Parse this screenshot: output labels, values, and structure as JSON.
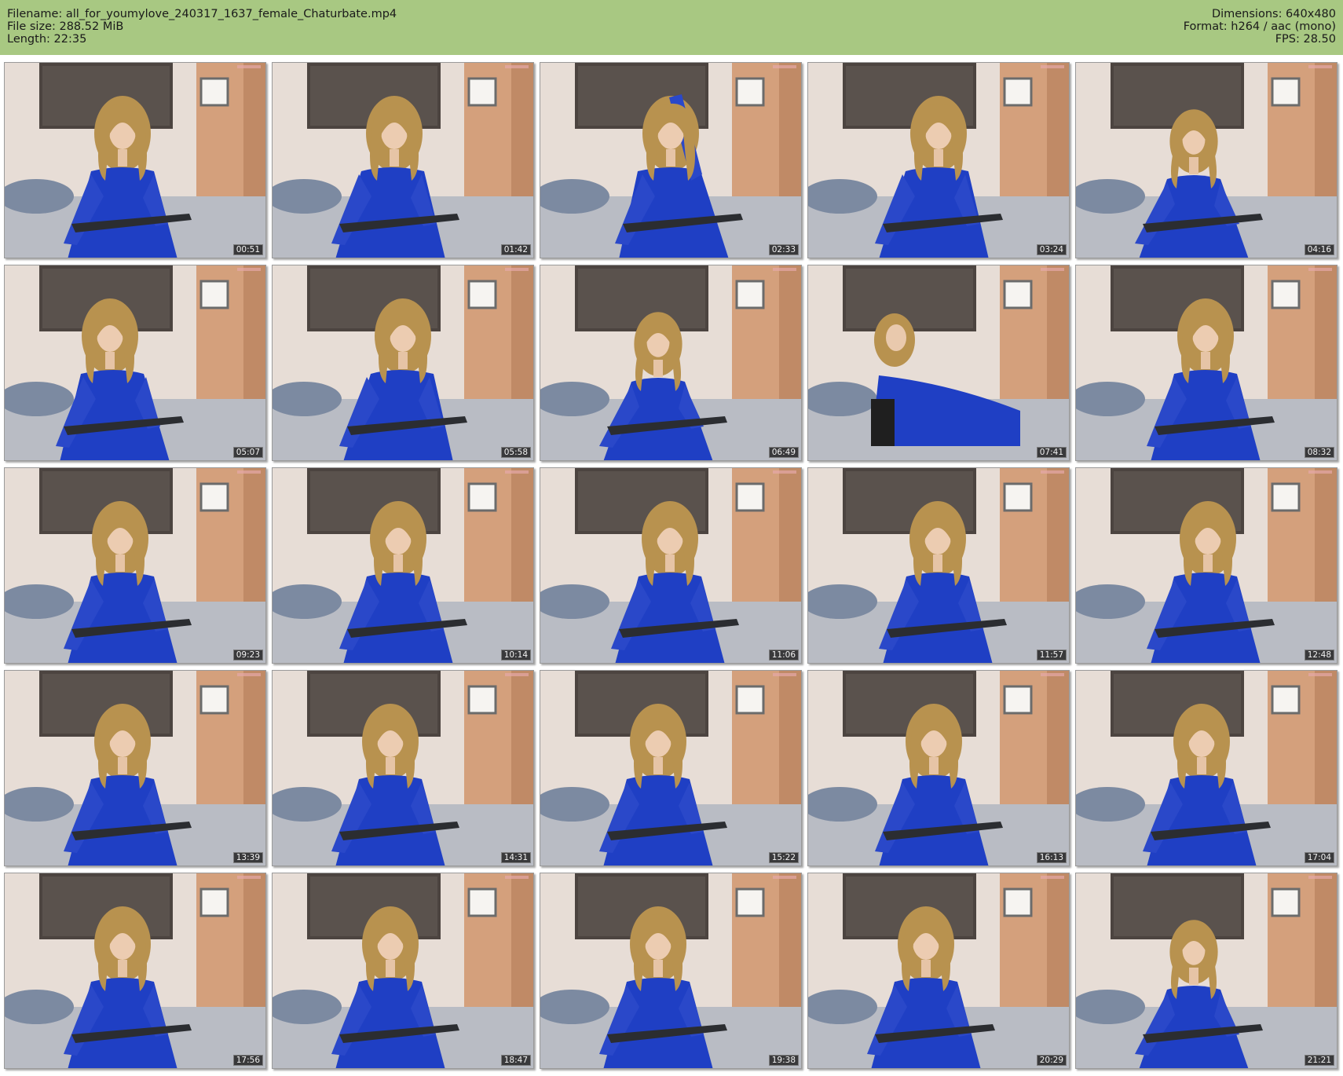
{
  "header": {
    "filename": "Filename: all_for_youmylove_240317_1637_female_Chaturbate.mp4",
    "file_size": "File size: 288.52 MiB",
    "length": "Length: 22:35",
    "dimensions": "Dimensions: 640x480",
    "format": "Format: h264 / aac (mono)",
    "fps": "FPS: 28.50"
  },
  "colors": {
    "header_bg": "#a8c882",
    "dress_blue": "#1f3fc4",
    "hair": "#b8924f",
    "wall": "#e7ddd6"
  },
  "thumbnails": [
    {
      "timestamp": "00:51"
    },
    {
      "timestamp": "01:42"
    },
    {
      "timestamp": "02:33"
    },
    {
      "timestamp": "03:24"
    },
    {
      "timestamp": "04:16"
    },
    {
      "timestamp": "05:07"
    },
    {
      "timestamp": "05:58"
    },
    {
      "timestamp": "06:49"
    },
    {
      "timestamp": "07:41"
    },
    {
      "timestamp": "08:32"
    },
    {
      "timestamp": "09:23"
    },
    {
      "timestamp": "10:14"
    },
    {
      "timestamp": "11:06"
    },
    {
      "timestamp": "11:57"
    },
    {
      "timestamp": "12:48"
    },
    {
      "timestamp": "13:39"
    },
    {
      "timestamp": "14:31"
    },
    {
      "timestamp": "15:22"
    },
    {
      "timestamp": "16:13"
    },
    {
      "timestamp": "17:04"
    },
    {
      "timestamp": "17:56"
    },
    {
      "timestamp": "18:47"
    },
    {
      "timestamp": "19:38"
    },
    {
      "timestamp": "20:29"
    },
    {
      "timestamp": "21:21"
    }
  ]
}
